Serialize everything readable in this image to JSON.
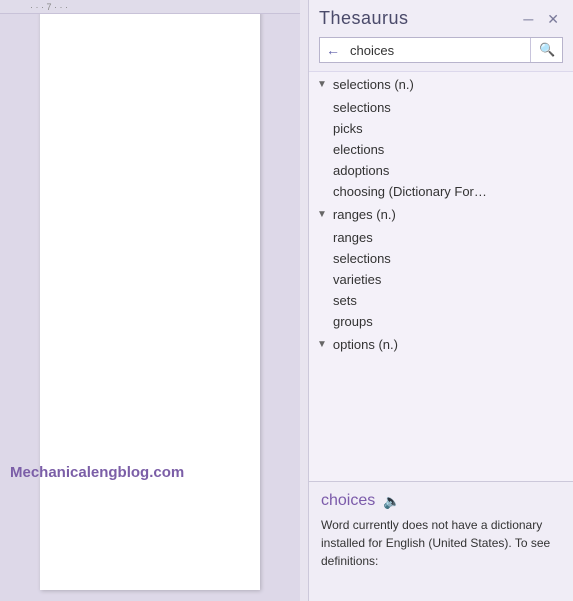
{
  "document": {
    "ruler_ticks": "· · · 7 · · ·"
  },
  "watermark": {
    "text": "Mechanicalengblog.com"
  },
  "thesaurus": {
    "title": "Thesaurus",
    "pin_icon": "📌",
    "close_icon": "✕",
    "search": {
      "placeholder": "choices",
      "value": "choices",
      "search_icon": "🔍"
    },
    "back_icon": "←",
    "groups": [
      {
        "label": "selections (n.)",
        "items": [
          "selections",
          "picks",
          "elections",
          "adoptions",
          "choosing (Dictionary For…"
        ]
      },
      {
        "label": "ranges (n.)",
        "items": [
          "ranges",
          "selections",
          "varieties",
          "sets",
          "groups"
        ]
      },
      {
        "label": "options (n.)",
        "items": []
      }
    ],
    "definition": {
      "word": "choices",
      "speaker_icon": "🔊",
      "text": "Word currently does not have a dictionary installed for English (United States). To see definitions:"
    }
  }
}
